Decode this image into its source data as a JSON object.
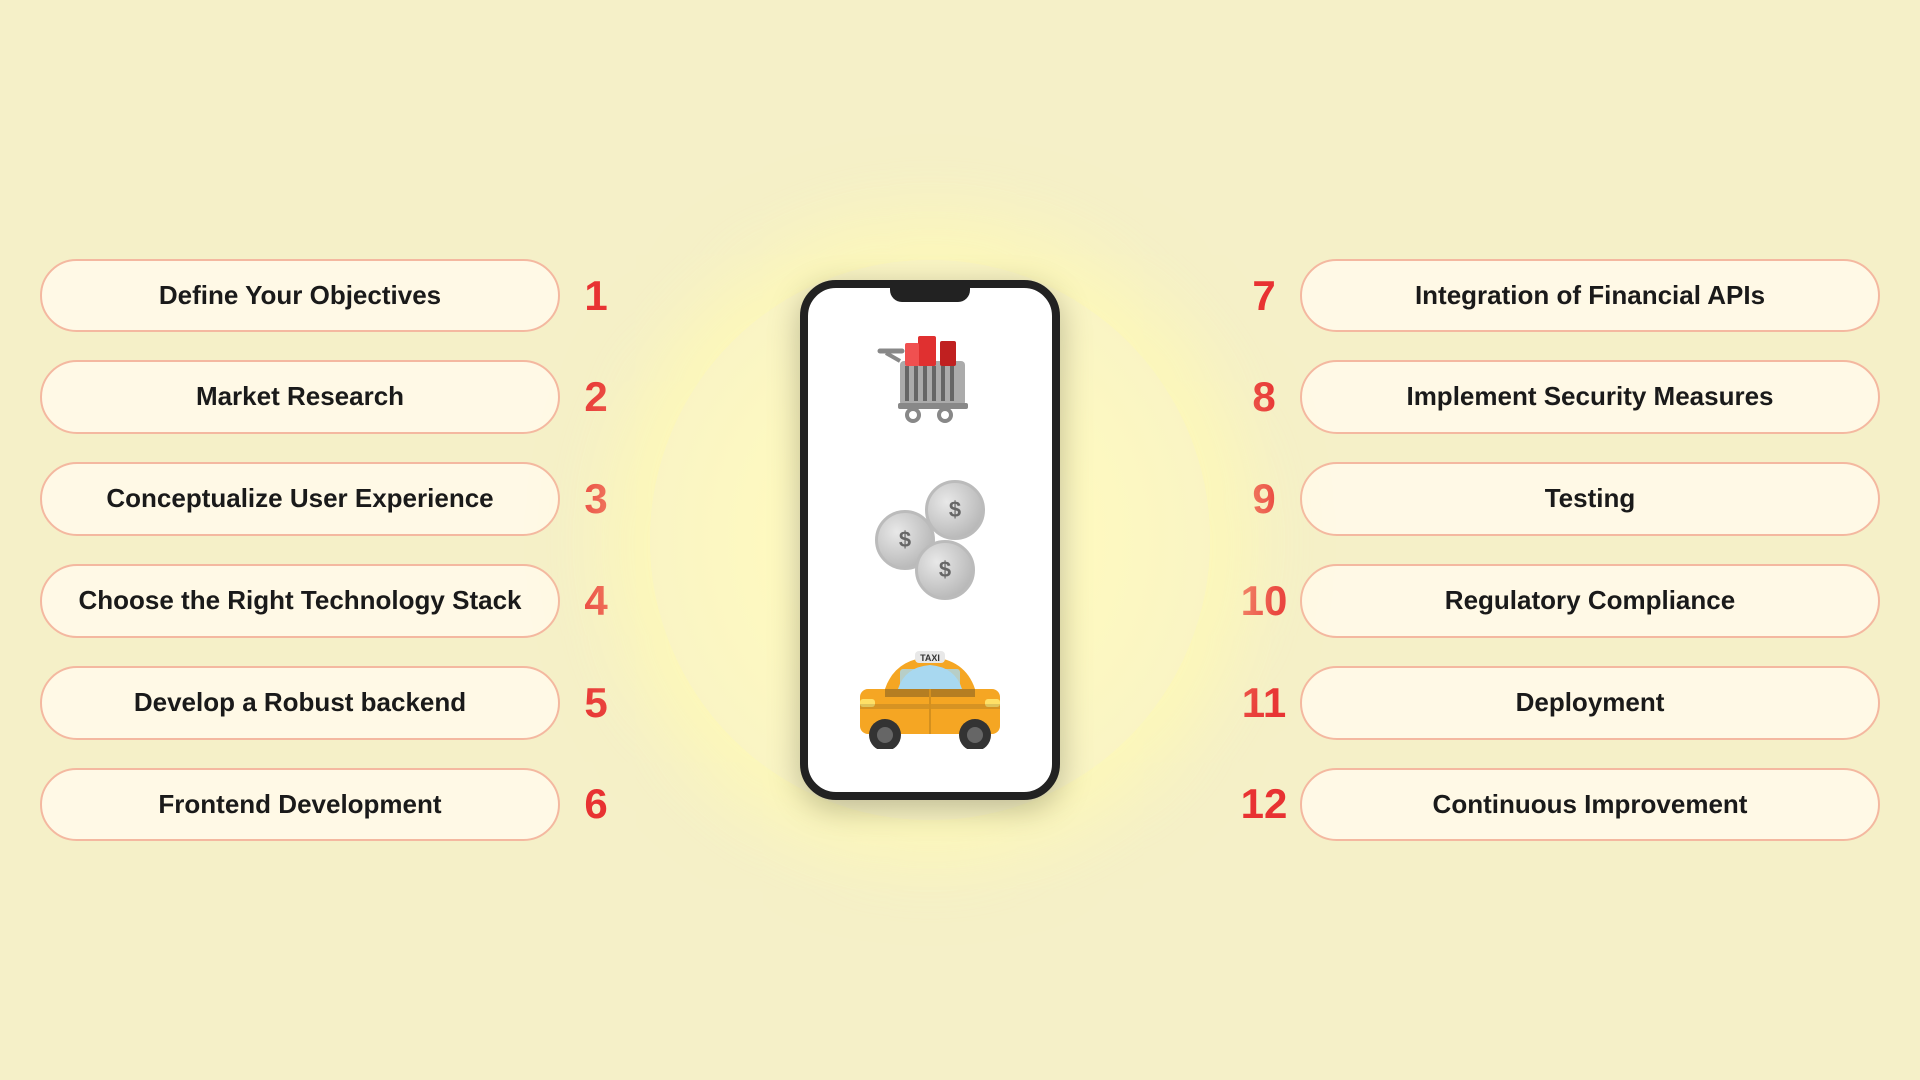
{
  "left_items": [
    {
      "number": "1",
      "label": "Define Your Objectives"
    },
    {
      "number": "2",
      "label": "Market Research"
    },
    {
      "number": "3",
      "label": "Conceptualize User Experience"
    },
    {
      "number": "4",
      "label": "Choose the Right Technology Stack"
    },
    {
      "number": "5",
      "label": "Develop a  Robust backend"
    },
    {
      "number": "6",
      "label": "Frontend Development"
    }
  ],
  "right_items": [
    {
      "number": "7",
      "label": "Integration of Financial APIs"
    },
    {
      "number": "8",
      "label": "Implement Security Measures"
    },
    {
      "number": "9",
      "label": "Testing"
    },
    {
      "number": "10",
      "label": "Regulatory Compliance"
    },
    {
      "number": "11",
      "label": "Deployment"
    },
    {
      "number": "12",
      "label": "Continuous Improvement"
    }
  ],
  "accent_color": "#e83232",
  "pill_bg": "#fff9e6",
  "pill_border": "#f4b8a0"
}
